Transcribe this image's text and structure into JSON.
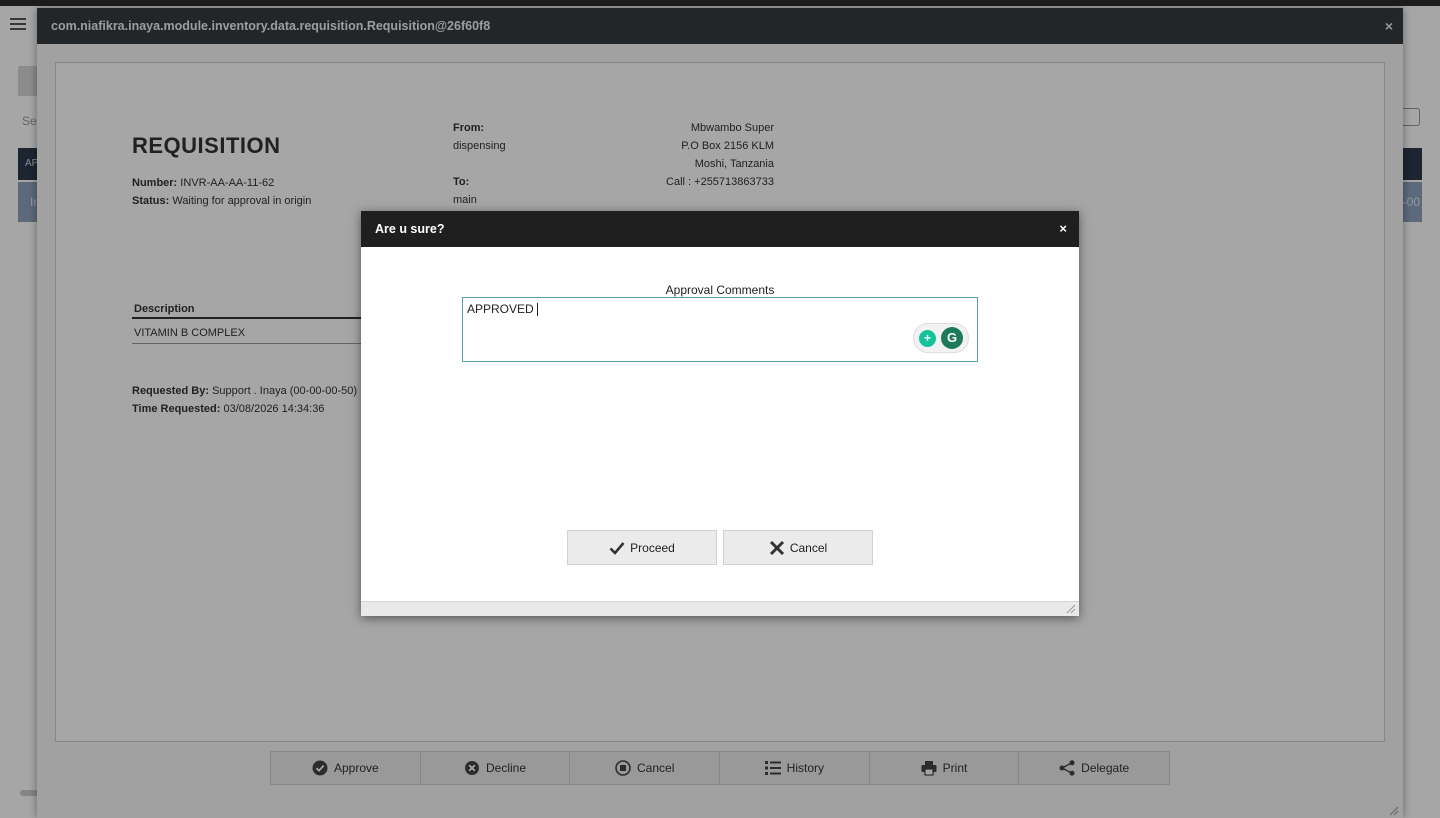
{
  "outer_window": {
    "title": "com.niafikra.inaya.module.inventory.data.requisition.Requisition@26f60f8",
    "close": "×"
  },
  "background": {
    "search_hint": "Se",
    "table_head_hint": "AP",
    "table_row_hint": "In",
    "table_row_hint_right": "-00"
  },
  "requisition": {
    "title": "REQUISITION",
    "number_label": "Number:",
    "number_value": "INVR-AA-AA-11-62",
    "status_label": "Status:",
    "status_value": "Waiting for approval in origin",
    "from_label": "From:",
    "from_value": "dispensing",
    "to_label": "To:",
    "to_value": "main",
    "address": {
      "name": "Mbwambo Super",
      "box": "P.O Box 2156 KLM",
      "city": "Moshi, Tanzania",
      "call": "Call : +255713863733"
    },
    "description_header": "Description",
    "items": [
      "VITAMIN B COMPLEX"
    ],
    "requested_by_label": "Requested By:",
    "requested_by_value": "Support . Inaya (00-00-00-50)",
    "time_requested_label": "Time Requested:",
    "time_requested_value": "03/08/2026 14:34:36"
  },
  "toolbar": {
    "approve": "Approve",
    "decline": "Decline",
    "cancel": "Cancel",
    "history": "History",
    "print": "Print",
    "delegate": "Delegate"
  },
  "dialog": {
    "title": "Are u sure?",
    "close": "×",
    "comments_label": "Approval Comments",
    "comments_value": "APPROVED",
    "proceed": "Proceed",
    "cancel": "Cancel"
  }
}
